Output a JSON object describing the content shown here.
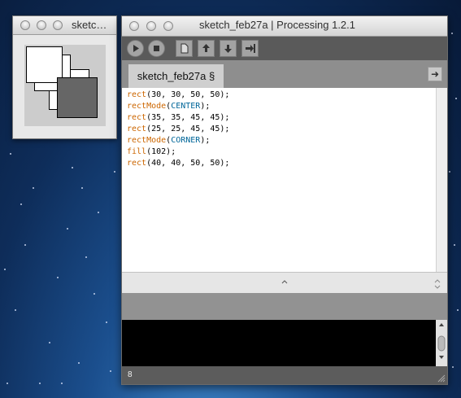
{
  "sketch_window": {
    "title": "sketc…"
  },
  "ide": {
    "title": "sketch_feb27a | Processing 1.2.1",
    "tab_label": "sketch_feb27a §",
    "code_lines": [
      [
        {
          "t": "rect",
          "c": "fn"
        },
        {
          "t": "(30, 30, 50, 50);",
          "c": ""
        }
      ],
      [
        {
          "t": "rectMode",
          "c": "fn"
        },
        {
          "t": "(",
          "c": ""
        },
        {
          "t": "CENTER",
          "c": "const"
        },
        {
          "t": ");",
          "c": ""
        }
      ],
      [
        {
          "t": "rect",
          "c": "fn"
        },
        {
          "t": "(35, 35, 45, 45);",
          "c": ""
        }
      ],
      [
        {
          "t": "rect",
          "c": "fn"
        },
        {
          "t": "(25, 25, 45, 45);",
          "c": ""
        }
      ],
      [
        {
          "t": "rectMode",
          "c": "fn"
        },
        {
          "t": "(",
          "c": ""
        },
        {
          "t": "CORNER",
          "c": "const"
        },
        {
          "t": ");",
          "c": ""
        }
      ],
      [
        {
          "t": "fill",
          "c": "fn"
        },
        {
          "t": "(102);",
          "c": ""
        }
      ],
      [
        {
          "t": "rect",
          "c": "fn"
        },
        {
          "t": "(40, 40, 50, 50);",
          "c": ""
        }
      ]
    ],
    "line_number": "8",
    "colors": {
      "function": "#cc6600",
      "constant": "#006699",
      "toolbar": "#5a5a5a",
      "console": "#000000"
    }
  }
}
